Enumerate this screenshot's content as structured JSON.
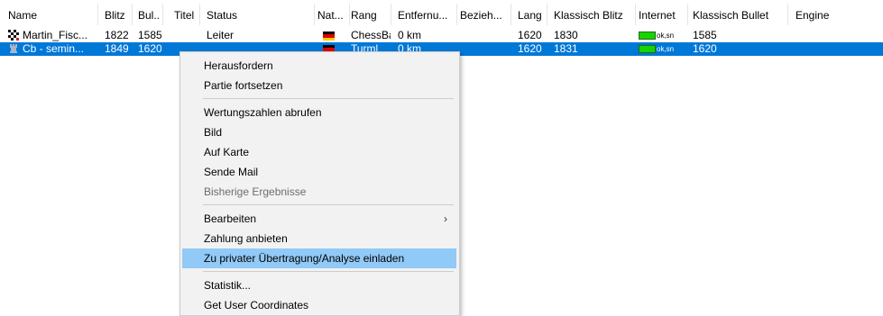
{
  "columns": [
    "Name",
    "Blitz",
    "Bul...",
    "Titel",
    "Status",
    "Nat...",
    "Rang",
    "Entfernu...",
    "Bezieh...",
    "Lang",
    "Klassisch Blitz",
    "Internet",
    "Klassisch Bullet",
    "Engine"
  ],
  "rows": [
    {
      "name": "Martin_Fisc...",
      "blitz": "1822",
      "bullet": "1585",
      "titel": "",
      "status": "Leiter",
      "nation": "germany-flag",
      "rang": "ChessBa:",
      "entfernung": "0 km",
      "beziehung": "",
      "lang": "1620",
      "klassisch_blitz": "1830",
      "internet": "ok,sn",
      "klassisch_bullet": "1585",
      "engine": "",
      "icon": "checkered-avatar-icon",
      "selected": false
    },
    {
      "name": "Cb - semin...",
      "blitz": "1849",
      "bullet": "1620",
      "titel": "",
      "status": "",
      "nation": "germany-flag",
      "rang": "Turml",
      "entfernung": "0 km",
      "beziehung": "",
      "lang": "1620",
      "klassisch_blitz": "1831",
      "internet": "ok,sn",
      "klassisch_bullet": "1620",
      "engine": "",
      "icon": "rook-icon",
      "selected": true
    }
  ],
  "context_menu": {
    "items": [
      {
        "label": "Herausfordern"
      },
      {
        "label": "Partie fortsetzen"
      },
      {
        "label": "Wertungszahlen abrufen"
      },
      {
        "label": "Bild"
      },
      {
        "label": "Auf Karte"
      },
      {
        "label": "Sende Mail"
      },
      {
        "label": "Bisherige Ergebnisse",
        "disabled": true
      },
      {
        "label": "Bearbeiten",
        "submenu": true
      },
      {
        "label": "Zahlung anbieten"
      },
      {
        "label": "Zu privater Übertragung/Analyse einladen",
        "highlighted": true
      },
      {
        "label": "Statistik..."
      },
      {
        "label": "Get User Coordinates"
      }
    ],
    "submenu_arrow": "›"
  },
  "colors": {
    "selection": "#0078d7",
    "menu_highlight": "#91c9f7",
    "menu_background": "#f2f2f2",
    "internet_ok": "#17d300",
    "flag_black": "#000000",
    "flag_red": "#dd0000",
    "flag_gold": "#ffce00"
  }
}
